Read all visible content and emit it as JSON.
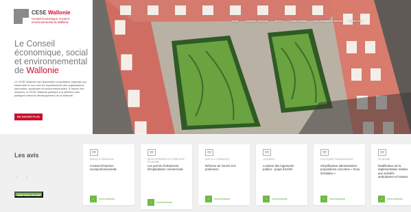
{
  "brand": {
    "name_prefix": "CESE",
    "name_accent": "Wallonie",
    "tagline": "Conseil économique, social et environnemental de Wallonie"
  },
  "nav": {
    "items": [
      "AVIS",
      "CONSULTATION",
      "ACTU",
      "FONCTIONS",
      "QUI SOMMES-NOUS",
      "EMPLOIS"
    ]
  },
  "hero": {
    "title_line": "Le Conseil économique, social et environnemental de",
    "title_accent": "Wallonie",
    "description": "Le CESE Wallonie est l'assemblée consultative régionale qui rassemble en son sein les représentants des organisations patronales, syndicales et environnementales. À travers ses missions, le CESE Wallonie participe à la définition des politiques visant le développement de la Wallonie.",
    "button_label": "EN SAVOIR PLUS"
  },
  "avis": {
    "title": "Les avis",
    "prev_arrow": "←",
    "next_arrow": "→",
    "all_button": "VOIR TOUS LES AVIS",
    "download_label": "TÉLÉCHARGER",
    "download_glyph": "↓",
    "cards": [
      {
        "category": "EMPLOI & FORMATION",
        "title": "Contrat d'insertion socioprofessionnelle"
      },
      {
        "category": "DÉVELOPPEMENT DU TERRITOIRE · ÉCONOMIE",
        "title": "Les permis d'urbanisme d'implantation commerciale"
      },
      {
        "category": "EMPLOI & FORMATION",
        "title": "Réforme de l'accès à la profession"
      },
      {
        "category": "LOGEMENT",
        "title": "Location des logements publics : projet d'arrêté"
      },
      {
        "category": "POLITIQUES TRANSVERSALES",
        "title": "Simplification administrative : propositions concrètes « Ecos d'initiative »"
      },
      {
        "category": "ÉCONOMIE",
        "title": "Modification de la réglementation relative aux activités ambulantes et foraines"
      }
    ]
  },
  "colors": {
    "accent_red": "#c8102e",
    "accent_green": "#6dbb45"
  }
}
